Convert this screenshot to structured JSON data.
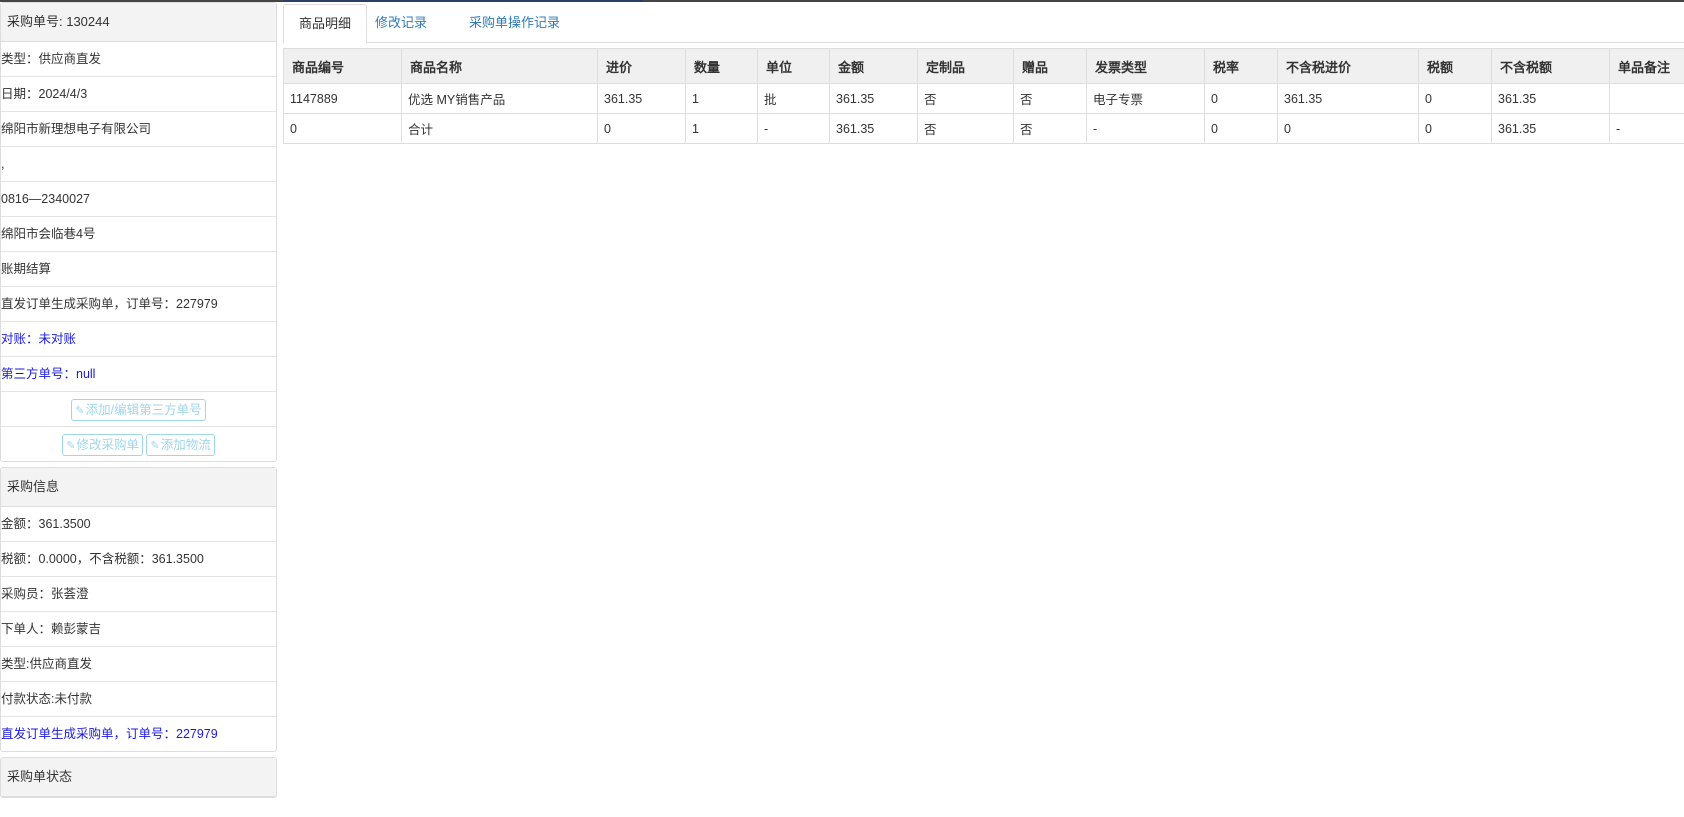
{
  "sidebar": {
    "order_panel": {
      "heading": "采购单号: 130244",
      "rows": [
        "类型：供应商直发",
        "日期：2024/4/3",
        "绵阳市新理想电子有限公司",
        ",",
        "0816—2340027",
        "绵阳市会临巷4号",
        "账期结算",
        "直发订单生成采购单，订单号：227979",
        "对账：未对账",
        "第三方单号：null"
      ],
      "btn_third_party": "添加/编辑第三方单号",
      "btn_edit_order": "修改采购单",
      "btn_add_logistics": "添加物流"
    },
    "purchase_panel": {
      "heading": "采购信息",
      "rows": [
        "金额：361.3500",
        "税额：0.0000，不含税额：361.3500",
        "采购员：张荟澄",
        "下单人：赖彭蒙吉",
        "类型:供应商直发",
        "付款状态:未付款",
        "直发订单生成采购单，订单号：227979"
      ]
    },
    "status_panel": {
      "heading": "采购单状态"
    }
  },
  "tabs": [
    "商品明细",
    "修改记录",
    "采购单操作记录"
  ],
  "table": {
    "headers": [
      "商品编号",
      "商品名称",
      "进价",
      "数量",
      "单位",
      "金额",
      "定制品",
      "赠品",
      "发票类型",
      "税率",
      "不含税进价",
      "税额",
      "不含税额",
      "单品备注"
    ],
    "rows": [
      [
        "1147889",
        "优选 MY销售产品",
        "361.35",
        "1",
        "批",
        "361.35",
        "否",
        "否",
        "电子专票",
        "0",
        "361.35",
        "0",
        "361.35",
        ""
      ],
      [
        "0",
        "合计",
        "0",
        "1",
        "-",
        "361.35",
        "否",
        "否",
        "-",
        "0",
        "0",
        "0",
        "361.35",
        "-"
      ]
    ]
  },
  "colors": {
    "link_blue": "#337ab7",
    "text_blue": "#1a1adf",
    "button_outline": "#9fd6ea",
    "panel_heading_bg": "#f3f3f3"
  },
  "icons": {
    "edit": "edit-icon"
  }
}
